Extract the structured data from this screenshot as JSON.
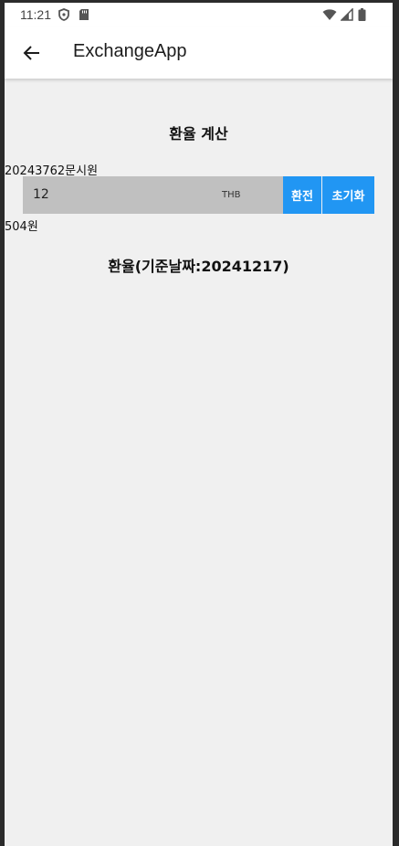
{
  "status_bar": {
    "time": "11:21",
    "left_icons": [
      "shield-icon",
      "sd-card-icon"
    ],
    "right_icons": [
      "wifi-icon",
      "signal-icon",
      "battery-icon"
    ]
  },
  "app_bar": {
    "title": "ExchangeApp",
    "back_icon": "arrow-left-icon"
  },
  "main": {
    "heading": "환율 계산",
    "student_info": "20243762문시원",
    "amount_input": {
      "value": "12",
      "currency": "THB"
    },
    "convert_button": "환전",
    "reset_button": "초기화",
    "result": "504원",
    "rate_heading": "환율(기준날짜:20241217)"
  },
  "colors": {
    "accent": "#2196f3",
    "input_bg": "#c0c0c0",
    "background": "#f0f0f0"
  }
}
